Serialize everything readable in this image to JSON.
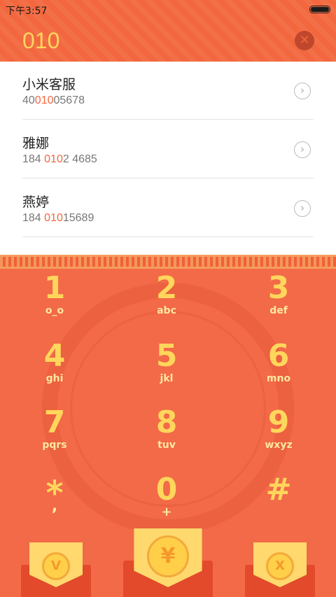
{
  "status_bar": {
    "time": "下午3:57"
  },
  "search": {
    "query": "010",
    "clear_symbol": "✕"
  },
  "results": [
    {
      "name": "小米客服",
      "num_pre": "40",
      "num_hl": "010",
      "num_post": "05678"
    },
    {
      "name": "雅娜",
      "num_pre": "184 ",
      "num_hl": "010",
      "num_post": "2 4685"
    },
    {
      "name": "燕婷",
      "num_pre": "184 ",
      "num_hl": "010",
      "num_post": "15689"
    }
  ],
  "row_arrow": "›",
  "keys": [
    {
      "digit": "1",
      "letters": "o_o"
    },
    {
      "digit": "2",
      "letters": "abc"
    },
    {
      "digit": "3",
      "letters": "def"
    },
    {
      "digit": "4",
      "letters": "ghi"
    },
    {
      "digit": "5",
      "letters": "jkl"
    },
    {
      "digit": "6",
      "letters": "mno"
    },
    {
      "digit": "7",
      "letters": "pqrs"
    },
    {
      "digit": "8",
      "letters": "tuv"
    },
    {
      "digit": "9",
      "letters": "wxyz"
    },
    {
      "digit": "*",
      "letters": ","
    },
    {
      "digit": "0",
      "letters": "+"
    },
    {
      "digit": "#",
      "letters": ""
    }
  ],
  "envelopes": {
    "left": "V",
    "center": "¥",
    "right": "X"
  },
  "colors": {
    "accent": "#f2673e",
    "highlight": "#ffd65c"
  }
}
